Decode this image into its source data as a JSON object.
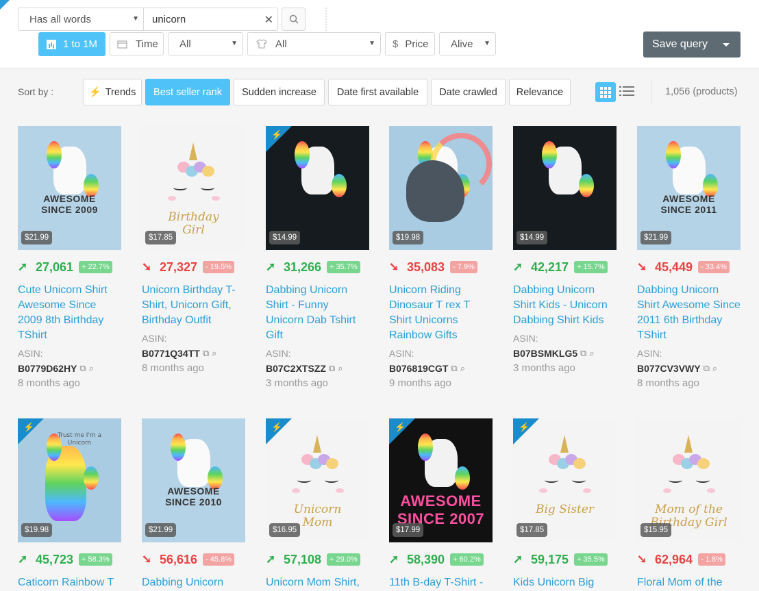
{
  "search": {
    "mode": "Has all words",
    "query": "unicorn",
    "clear_icon": "x-icon",
    "search_icon": "search-icon"
  },
  "filters": {
    "range_label": "1 to 1M",
    "time_label": "Time",
    "category_value": "All",
    "type_value": "All",
    "price_label": "Price",
    "status_value": "Alive"
  },
  "save_query_label": "Save query",
  "sort": {
    "label": "Sort by :",
    "options": [
      "Trends",
      "Best seller rank",
      "Sudden increase",
      "Date first available",
      "Date crawled",
      "Relevance"
    ],
    "active": "Best seller rank"
  },
  "count_label": "1,056 (products)",
  "asin_label": "ASIN:",
  "colors": {
    "accent": "#4fc3f7",
    "link": "#2a9fd8",
    "up": "#2fae4e",
    "down": "#e84343",
    "save": "#5f6b73"
  },
  "products": [
    {
      "price": "$21.99",
      "rank": "27,061",
      "trend": "up",
      "change": "+ 22.7%",
      "title": "Cute Unicorn Shirt Awesome Since 2009 8th Birthday TShirt",
      "asin": "B0779D62HY",
      "ago": "8 months ago",
      "art_text": "AWESOME\nSINCE 2009",
      "new_badge": false
    },
    {
      "price": "$17.85",
      "rank": "27,327",
      "trend": "down",
      "change": "- 19.5%",
      "title": "Unicorn Birthday T-Shirt, Unicorn Gift, Birthday Outfit",
      "asin": "B0771Q34TT",
      "ago": "8 months ago",
      "art_text": "Birthday\nGirl",
      "new_badge": false
    },
    {
      "price": "$14.99",
      "rank": "31,266",
      "trend": "up",
      "change": "+ 35.7%",
      "title": "Dabbing Unicorn Shirt - Funny Unicorn Dab Tshirt Gift",
      "asin": "B07C2XTSZZ",
      "ago": "3 months ago",
      "art_text": "",
      "new_badge": true
    },
    {
      "price": "$19.98",
      "rank": "35,083",
      "trend": "down",
      "change": "- 7.9%",
      "title": "Unicorn Riding Dinosaur T rex T Shirt Unicorns Rainbow Gifts",
      "asin": "B076819CGT",
      "ago": "9 months ago",
      "art_text": "",
      "new_badge": false
    },
    {
      "price": "$14.99",
      "rank": "42,217",
      "trend": "up",
      "change": "+ 15.7%",
      "title": "Dabbing Unicorn Shirt Kids - Unicorn Dabbing Shirt Kids",
      "asin": "B07BSMKLG5",
      "ago": "3 months ago",
      "art_text": "",
      "new_badge": false
    },
    {
      "price": "$21.99",
      "rank": "45,449",
      "trend": "down",
      "change": "- 33.4%",
      "title": "Dabbing Unicorn Shirt Awesome Since 2011 6th Birthday TShirt",
      "asin": "B077CV3VWY",
      "ago": "8 months ago",
      "art_text": "AWESOME\nSINCE 2011",
      "new_badge": false
    },
    {
      "price": "$19.98",
      "rank": "45,723",
      "trend": "up",
      "change": "+ 58.3%",
      "title": "Caticorn Rainbow T",
      "asin": "",
      "ago": "",
      "art_text": "Trust me I'm a Unicorn",
      "new_badge": true
    },
    {
      "price": "$21.99",
      "rank": "56,616",
      "trend": "down",
      "change": "- 45.8%",
      "title": "Dabbing Unicorn",
      "asin": "",
      "ago": "",
      "art_text": "AWESOME\nSINCE 2010",
      "new_badge": false
    },
    {
      "price": "$16.95",
      "rank": "57,108",
      "trend": "up",
      "change": "+ 29.0%",
      "title": "Unicorn Mom Shirt,",
      "asin": "",
      "ago": "",
      "art_text": "Unicorn\nMom",
      "new_badge": true
    },
    {
      "price": "$17.99",
      "rank": "58,390",
      "trend": "up",
      "change": "+ 60.2%",
      "title": "11th B-day T-Shirt -",
      "asin": "",
      "ago": "",
      "art_text": "AWESOME\nSINCE 2007",
      "new_badge": true
    },
    {
      "price": "$17.85",
      "rank": "59,175",
      "trend": "up",
      "change": "+ 35.5%",
      "title": "Kids Unicorn Big",
      "asin": "",
      "ago": "",
      "art_text": "Big Sister",
      "new_badge": true
    },
    {
      "price": "$15.95",
      "rank": "62,964",
      "trend": "down",
      "change": "- 1.8%",
      "title": "Floral Mom of the",
      "asin": "",
      "ago": "",
      "art_text": "Mom of the\nBirthday Girl",
      "new_badge": false
    }
  ]
}
